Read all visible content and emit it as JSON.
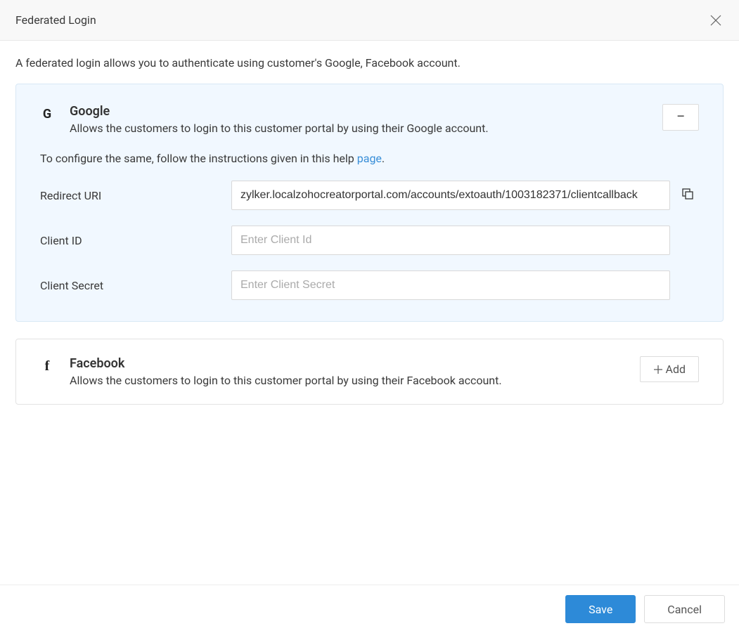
{
  "header": {
    "title": "Federated Login"
  },
  "intro": "A federated login allows you to authenticate using customer's Google, Facebook account.",
  "google": {
    "title": "Google",
    "desc": "Allows the customers to login to this customer portal by using their Google account.",
    "instruction_prefix": "To configure the same, follow the instructions given in this help ",
    "instruction_link": "page",
    "instruction_suffix": ".",
    "fields": {
      "redirect_uri_label": "Redirect URI",
      "redirect_uri_value": "zylker.localzohocreatorportal.com/accounts/extoauth/1003182371/clientcallback",
      "client_id_label": "Client ID",
      "client_id_placeholder": "Enter Client Id",
      "client_id_value": "",
      "client_secret_label": "Client Secret",
      "client_secret_placeholder": "Enter Client Secret",
      "client_secret_value": ""
    }
  },
  "facebook": {
    "title": "Facebook",
    "desc": "Allows the customers to login to this customer portal by using their Facebook account.",
    "add_label": "Add"
  },
  "footer": {
    "save_label": "Save",
    "cancel_label": "Cancel"
  }
}
